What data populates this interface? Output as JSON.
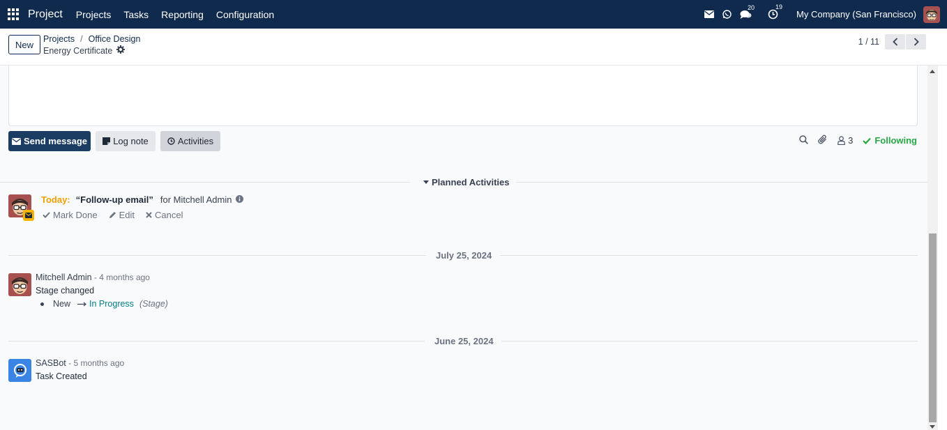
{
  "navbar": {
    "brand": "Project",
    "menu": [
      "Projects",
      "Tasks",
      "Reporting",
      "Configuration"
    ],
    "messages_badge": "20",
    "activities_badge": "19",
    "company": "My Company (San Francisco)"
  },
  "control_panel": {
    "new_label": "New",
    "breadcrumb": [
      "Projects",
      "Office Design"
    ],
    "breadcrumb_sep": "/",
    "record_title": "Energy Certificate",
    "pager": "1 / 11"
  },
  "chatter": {
    "send_message": "Send message",
    "log_note": "Log note",
    "activities": "Activities",
    "followers_count": "3",
    "following": "Following"
  },
  "planned": {
    "header": "Planned Activities",
    "activity": {
      "when": "Today:",
      "summary": "“Follow-up email”",
      "for": "for Mitchell Admin",
      "mark_done": "Mark Done",
      "edit": "Edit",
      "cancel": "Cancel"
    }
  },
  "thread": {
    "date1": "July 25, 2024",
    "msg1": {
      "author": "Mitchell Admin",
      "date": " - 4 months ago",
      "body": "Stage changed",
      "old_value": "New",
      "new_value": "In Progress",
      "field": "(Stage)"
    },
    "date2": "June 25, 2024",
    "msg2": {
      "author": "SASBot",
      "date": " - 5 months ago",
      "body": "Task Created"
    }
  },
  "colors": {
    "navbar_bg": "#0f2a4d",
    "primary_button": "#1b3c63",
    "today": "#f0a000",
    "following": "#28a745",
    "tracking_new": "#017e84"
  }
}
